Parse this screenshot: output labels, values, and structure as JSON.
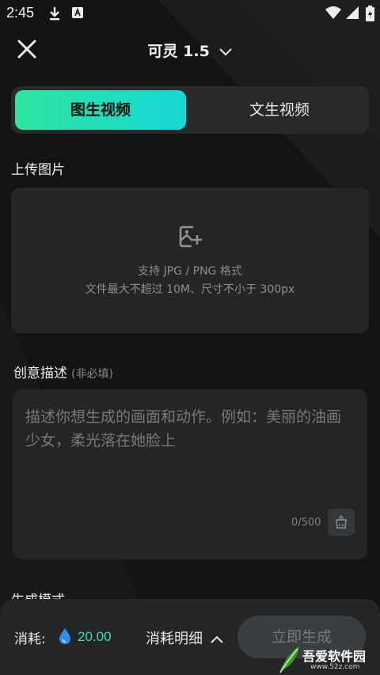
{
  "status_bar": {
    "time": "2:45"
  },
  "header": {
    "title": "可灵 1.5"
  },
  "tabs": [
    {
      "label": "图生视频",
      "active": true
    },
    {
      "label": "文生视频",
      "active": false
    }
  ],
  "upload": {
    "section_label": "上传图片",
    "line1": "支持 JPG / PNG 格式",
    "line2": "文件最大不超过 10M、尺寸不小于 300px"
  },
  "description": {
    "section_label": "创意描述",
    "optional_hint": "(非必填)",
    "placeholder": "描述你想生成的画面和动作。例如：美丽的油画少女，柔光落在她脸上",
    "counter": "0/500"
  },
  "mode": {
    "section_label": "生成模式"
  },
  "footer": {
    "cost_label": "消耗:",
    "cost_value": "20.00",
    "detail_label": "消耗明细",
    "generate_label": "立即生成"
  },
  "watermark": {
    "text": "吾爱软件园",
    "sub": "www.52z.com"
  },
  "colors": {
    "accent_start": "#2fe6a0",
    "accent_end": "#16d6d6",
    "cost_value": "#33e0bd",
    "background": "#121314",
    "card": "#232527"
  }
}
